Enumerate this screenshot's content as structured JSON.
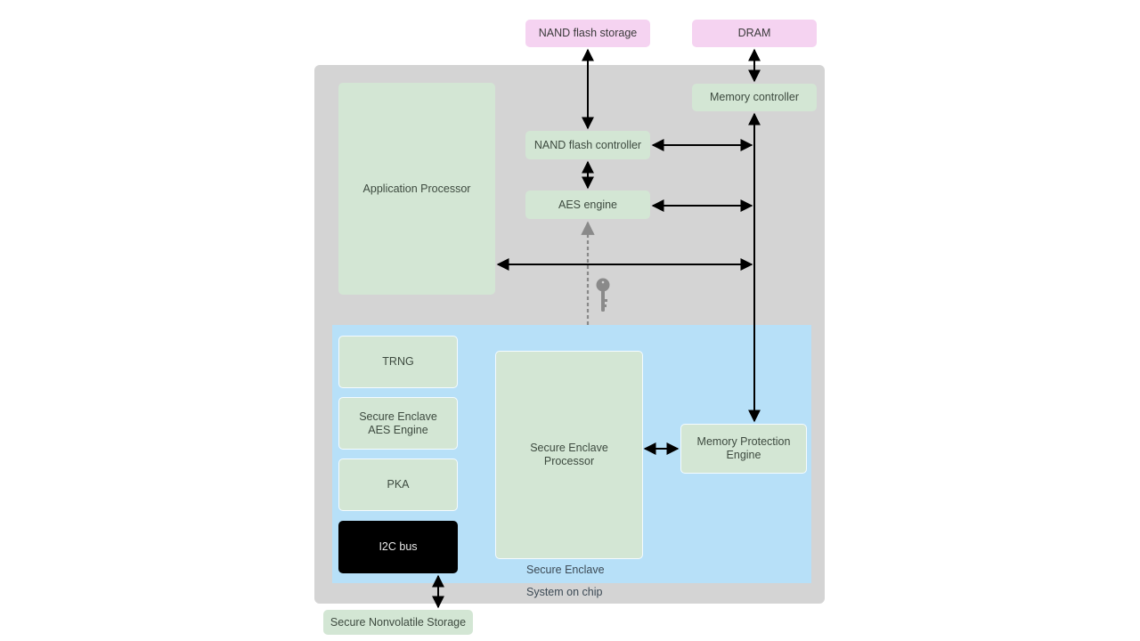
{
  "diagram": {
    "external": {
      "nand_storage": "NAND flash storage",
      "dram": "DRAM",
      "secure_nonvolatile_storage": "Secure Nonvolatile Storage"
    },
    "soc": {
      "label": "System on chip",
      "application_processor": "Application Processor",
      "memory_controller": "Memory controller",
      "nand_controller": "NAND flash controller",
      "aes_engine": "AES engine"
    },
    "secure_enclave": {
      "label": "Secure Enclave",
      "trng": "TRNG",
      "se_aes_engine": "Secure Enclave AES Engine",
      "pka": "PKA",
      "i2c_bus": "I2C bus",
      "se_processor": "Secure Enclave Processor",
      "memory_protection_engine": "Memory Protection Engine"
    },
    "icons": {
      "key": "key-icon"
    },
    "colors": {
      "external_memory": "#f5d3f1",
      "component": "#d3e6d4",
      "soc_background": "#d4d4d4",
      "secure_enclave_background": "#b7e0f8",
      "i2c_bus": "#000000",
      "key_path": "#8a8a8a"
    }
  }
}
